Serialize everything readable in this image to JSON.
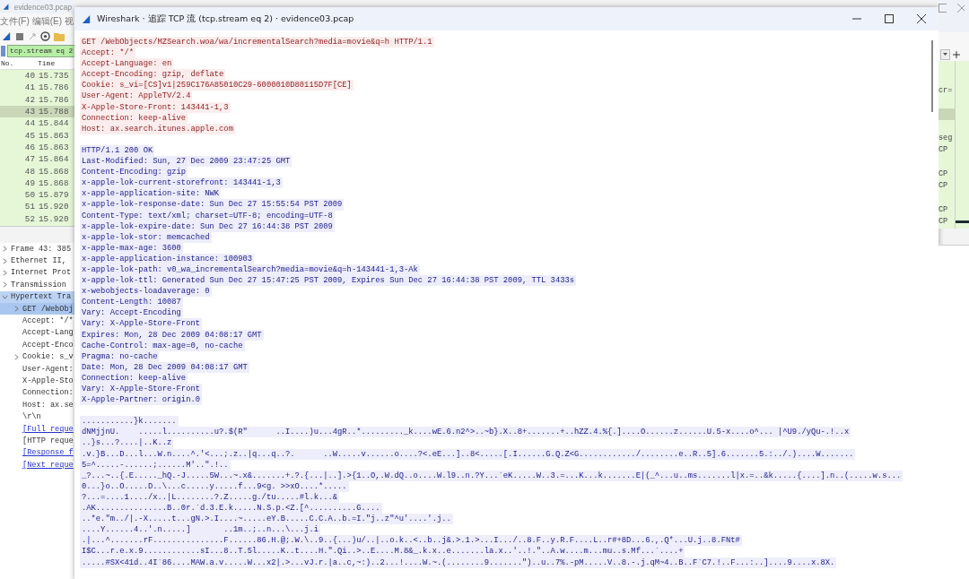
{
  "background_window": {
    "title": "evidence03.pcap",
    "menu": [
      "文件(F)",
      "编辑(E)",
      "视"
    ],
    "filter": "tcp.stream eq 2",
    "packet_list": {
      "columns": [
        "No.",
        "Time"
      ],
      "rows": [
        {
          "no": "40",
          "time": "15.735",
          "info": "",
          "selected": false
        },
        {
          "no": "41",
          "time": "15.786",
          "info": "cr=",
          "selected": false
        },
        {
          "no": "42",
          "time": "15.786",
          "info": "",
          "selected": false
        },
        {
          "no": "43",
          "time": "15.788",
          "info": "",
          "selected": true
        },
        {
          "no": "44",
          "time": "15.844",
          "info": "",
          "selected": false
        },
        {
          "no": "45",
          "time": "15.863",
          "info": "seg",
          "selected": false
        },
        {
          "no": "46",
          "time": "15.863",
          "info": "CP",
          "selected": false
        },
        {
          "no": "47",
          "time": "15.864",
          "info": "",
          "selected": false
        },
        {
          "no": "48",
          "time": "15.868",
          "info": "CP",
          "selected": false
        },
        {
          "no": "49",
          "time": "15.868",
          "info": "CP",
          "selected": false
        },
        {
          "no": "50",
          "time": "15.879",
          "info": "",
          "selected": false
        },
        {
          "no": "51",
          "time": "15.920",
          "info": "CP",
          "selected": false
        },
        {
          "no": "52",
          "time": "15.920",
          "info": "CP",
          "selected": false
        }
      ]
    },
    "details": [
      {
        "label": "Frame 43: 385",
        "kind": "text",
        "expanded": false,
        "selected": false
      },
      {
        "label": "Ethernet II,",
        "kind": "text",
        "expanded": false,
        "selected": false
      },
      {
        "label": "Internet Prot",
        "kind": "text",
        "expanded": false,
        "selected": false
      },
      {
        "label": "Transmission",
        "kind": "text",
        "expanded": false,
        "selected": false
      },
      {
        "label": "Hypertext Tra",
        "kind": "text",
        "expanded": true,
        "selected": true,
        "children": [
          {
            "label": "GET /WebObj",
            "kind": "text",
            "expanded": false,
            "selected": true
          },
          {
            "label": "Accept: */*",
            "kind": "text",
            "selected": false
          },
          {
            "label": "Accept-Lang",
            "kind": "text",
            "selected": false
          },
          {
            "label": "Accept-Enco",
            "kind": "text",
            "selected": false
          },
          {
            "label": "Cookie: s_v",
            "kind": "text",
            "expanded": false,
            "selected": false
          },
          {
            "label": "User-Agent:",
            "kind": "text",
            "selected": false
          },
          {
            "label": "X-Apple-Sto",
            "kind": "text",
            "selected": false
          },
          {
            "label": "Connection:",
            "kind": "text",
            "selected": false
          },
          {
            "label": "Host: ax.se",
            "kind": "text",
            "selected": false
          },
          {
            "label": "\\r\\n",
            "kind": "text",
            "selected": false
          },
          {
            "label": "[Full reque",
            "kind": "link",
            "selected": false
          },
          {
            "label": "[HTTP reque",
            "kind": "text",
            "selected": false
          },
          {
            "label": "[Response f",
            "kind": "link",
            "selected": false
          },
          {
            "label": "[Next reque",
            "kind": "link",
            "selected": false
          }
        ]
      }
    ]
  },
  "dialog": {
    "title": "Wireshark · 追踪 TCP 流 (tcp.stream eq 2) · evidence03.pcap",
    "stream": [
      {
        "kind": "client",
        "lines": [
          "GET /WebObjects/MZSearch.woa/wa/incrementalSearch?media=movie&q=h HTTP/1.1",
          "Accept: */*",
          "Accept-Language: en",
          "Accept-Encoding: gzip, deflate",
          "Cookie: s_vi=[CS]v1|259C176A85010C29-6000010D80115D7F[CE]",
          "User-Agent: AppleTV/2.4",
          "X-Apple-Store-Front: 143441-1,3",
          "Connection: keep-alive",
          "Host: ax.search.itunes.apple.com"
        ]
      },
      {
        "kind": "server",
        "lines": [
          "HTTP/1.1 200 OK",
          "Last-Modified: Sun, 27 Dec 2009 23:47:25 GMT",
          "Content-Encoding: gzip",
          "x-apple-lok-current-storefront: 143441-1,3",
          "x-apple-application-site: NWK",
          "x-apple-lok-response-date: Sun Dec 27 15:55:54 PST 2009",
          "Content-Type: text/xml; charset=UTF-8; encoding=UTF-8",
          "x-apple-lok-expire-date: Sun Dec 27 16:44:38 PST 2009",
          "x-apple-lok-stor: memcached",
          "x-apple-max-age: 3600",
          "x-apple-application-instance: 100903",
          "x-apple-lok-path: v0_wa_incrementalSearch?media=movie&q=h-143441-1,3-Ak",
          "x-apple-lok-ttl: Generated Sun Dec 27 15:47:25 PST 2009, Expires Sun Dec 27 16:44:38 PST 2009, TTL 3433s",
          "x-webobjects-loadaverage: 0",
          "Content-Length: 10087",
          "Vary: Accept-Encoding",
          "Vary: X-Apple-Store-Front",
          "Expires: Mon, 28 Dec 2009 04:08:17 GMT",
          "Cache-Control: max-age=0, no-cache",
          "Pragma: no-cache",
          "Date: Mon, 28 Dec 2009 04:08:17 GMT",
          "Connection: keep-alive",
          "Vary: X-Apple-Store-Front",
          "X-Apple-Partner: origin.0"
        ]
      },
      {
        "kind": "server",
        "lines": [
          "...........}k.......",
          "dNMjjnU.    .....l..........u?.$(R\"      ..I....)u...4gR..*........._k....wE.6.n2^>..~b}.X..8+.......+..hZZ.4.%{.]....O......z......U.5-x....o^... |^U9./yQu-.!..x",
          "..}s...?....|..K..z",
          ".v.}B...D...l...W.n....^.'<...;.z..|q...q..?.      ..W.....v......o....?<.eE...]..8<.....[.I......G.Q.Z<G............/........e..R..5].6.......5.:../.)....W.......",
          "5=^.....-......;......M'..\".!..",
          "_?...~..{.E....._hQ.-J.....5W...~.x&.......+.?.{...|..].>{1..O,.W.dQ..o....W.l9..n.?Y...`eK.....W..3.=...K...k.......E|(_^...u..ms.......l|x.=..&k.....{....].n..(.....w.s...",
          "0...}o..O.....D..\\...c.....y.....f...9<g. >>xO....*.....",
          "?...=....1..../x..|L........?.Z.....g./tu.....#l.k...&",
          ".AK...............B..0r.`d.3.E.k.....N.S.p.<Z.[^..........G....",
          "..*e.\"m../|.-X.....t...gN.>.I....~.....eY.B.....C.C.A..b.=I.\"j..z\"^u'....'.j..",
          "....Y......4..'.n.....]       ..1m..;..n...\\...j.i",
          ".|...^.......rF...............F......86.H.@;.W.\\..9..{...)u/..|..o.k..<..b..j&.>.1.>...I.../..8.F..y.R.F....L..r#+8D...6.,.Q*...U.j..8.FNt#",
          "I$C...r.e.x.9............sI...8..T.5l.....K..t....H.\".Qi..>..E....M.8&_.k.x..e.......la.x..'..!.\"..A.w....m...mu..s.Mf...`....+",
          ".....#SX<41d..4I`86....MAW.a.v.....W...x2|.>...vJ.r.|a..c,~:)..2...!....W.~.(........9.......\")..u..7%.-pM.....V..8.-.j.qM~4..B..F`C7.!..F...:..]....9....x.8X."
        ]
      }
    ]
  }
}
